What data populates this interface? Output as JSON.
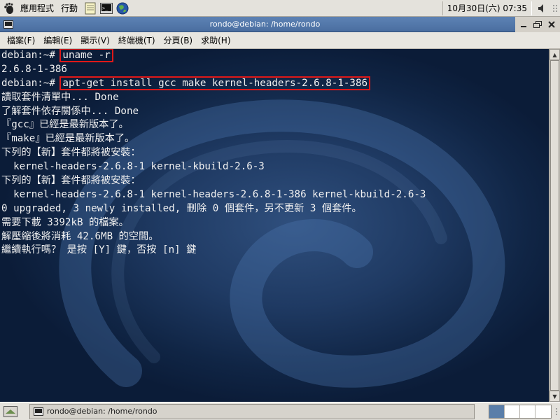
{
  "top_panel": {
    "applications_label": "應用程式",
    "actions_label": "行動",
    "clock_text": "10月30日(六) 07:35",
    "launchers": [
      "notepad-icon",
      "terminal-icon",
      "web-browser-icon"
    ]
  },
  "window": {
    "title": "rondo@debian: /home/rondo",
    "buttons": [
      "minimize",
      "maximize",
      "close"
    ]
  },
  "menubar": {
    "items": [
      "檔案(F)",
      "編輯(E)",
      "顯示(V)",
      "終端機(T)",
      "分頁(B)",
      "求助(H)"
    ]
  },
  "terminal": {
    "lines": [
      {
        "prompt": "debian:~# ",
        "command": "uname -r",
        "highlighted": true
      },
      {
        "text": "2.6.8-1-386"
      },
      {
        "prompt": "debian:~# ",
        "command": "apt-get install gcc make kernel-headers-2.6.8-1-386",
        "highlighted": true
      },
      {
        "text": "讀取套件清單中... Done"
      },
      {
        "text": "了解套件依存關係中... Done"
      },
      {
        "text": "『gcc』已經是最新版本了。"
      },
      {
        "text": "『make』已經是最新版本了。"
      },
      {
        "text": "下列的【新】套件都將被安裝："
      },
      {
        "text": "  kernel-headers-2.6.8-1 kernel-kbuild-2.6-3"
      },
      {
        "text": "下列的【新】套件都將被安裝："
      },
      {
        "text": "  kernel-headers-2.6.8-1 kernel-headers-2.6.8-1-386 kernel-kbuild-2.6-3"
      },
      {
        "text": "0 upgraded, 3 newly installed, 刪除 0 個套件，另不更新 3 個套件。"
      },
      {
        "text": "需要下載 3392kB 的檔案。"
      },
      {
        "text": "解壓縮後將消耗 42.6MB 的空間。"
      },
      {
        "text": "繼續執行嗎？ 是按 [Y] 鍵，否按 [n] 鍵"
      }
    ],
    "highlight_color": "#e01818"
  },
  "taskbar": {
    "task_label": "rondo@debian: /home/rondo",
    "workspaces": 4,
    "active_workspace": 1
  },
  "colors": {
    "titlebar": "#4a6ea0",
    "terminal_bg": "#1f3a63",
    "terminal_text": "#f0f0f0",
    "active_workspace": "#5a7ea9"
  }
}
